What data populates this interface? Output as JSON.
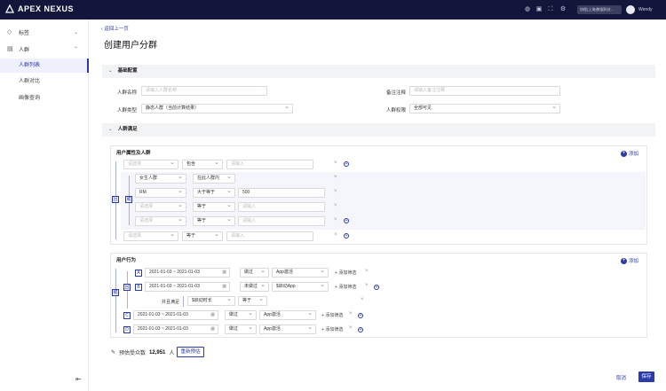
{
  "app": {
    "name": "APEX NEXUS",
    "tenant": "协程(上海)数据科技...",
    "user": "Wendy"
  },
  "sidebar": {
    "groups": [
      {
        "label": "标签",
        "icon": "tag-icon"
      },
      {
        "label": "人群",
        "icon": "crowd-icon"
      }
    ],
    "items": [
      {
        "label": "人群列表"
      },
      {
        "label": "人群对比"
      },
      {
        "label": "画像查询"
      }
    ]
  },
  "page": {
    "back": "返回上一页",
    "title": "创建用户分群"
  },
  "basic": {
    "title": "基础配置",
    "name_label": "人群名称",
    "name_placeholder": "请输入人群名称",
    "note_label": "备注注释",
    "note_placeholder": "请输入备注注释",
    "type_label": "人群类型",
    "type_value": "静态人群（当前计算结果）",
    "perm_label": "人群权限",
    "perm_value": "全部可见"
  },
  "cond": {
    "title": "人群满足"
  },
  "attr": {
    "title": "用户属性及人群",
    "add": "添加",
    "select_ph": "请选择",
    "input_ph": "请输入",
    "op_contains": "包含",
    "op_eq": "等于",
    "and": "且",
    "or": "或",
    "nested": [
      {
        "field": "女生人群",
        "op": "在此人群内",
        "val": ""
      },
      {
        "field": "RM",
        "op": "大于等于",
        "val": "500"
      },
      {
        "field": "",
        "op": "等于",
        "val": ""
      },
      {
        "field": "",
        "op": "等于",
        "val": ""
      }
    ]
  },
  "behavior": {
    "title": "用户行为",
    "add": "添加",
    "or": "或",
    "and": "且",
    "filter_add": "添加筛选",
    "also": "并且满足",
    "prop": "$启动时长",
    "prop_op": "等于",
    "rows": [
      {
        "badge": "A",
        "date": "2021-01-03 ~ 2021-01-03",
        "done": "做过",
        "event": "App激活"
      },
      {
        "badge": "B",
        "date": "2021-01-03 ~ 2021-01-03",
        "done": "未做过",
        "event": "$启动App"
      },
      {
        "badge": "C",
        "date": "2021-01-03 ~ 2021-01-03",
        "done": "做过",
        "event": "App激活"
      },
      {
        "badge": "D",
        "date": "2021-01-03 ~ 2021-01-03",
        "done": "做过",
        "event": "App激活"
      }
    ]
  },
  "estimate": {
    "prefix": "预估受众数",
    "count": "12,951",
    "unit": "人",
    "button": "重新预估"
  },
  "footer": {
    "cancel": "取消",
    "save": "保存"
  }
}
